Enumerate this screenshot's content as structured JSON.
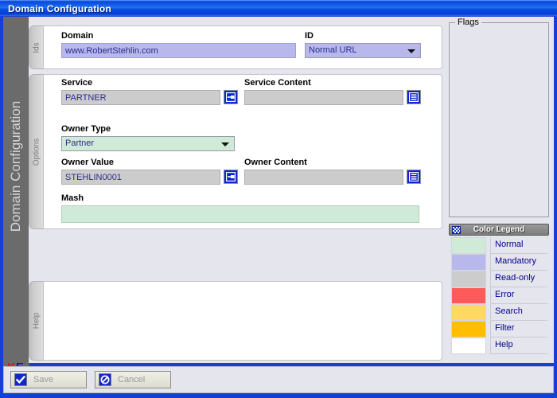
{
  "window": {
    "title": "Domain Configuration"
  },
  "rail": {
    "vertical_title": "Domain Configuration",
    "logo_k": "K",
    "logo_e": "E"
  },
  "tabs": [
    {
      "id": "ids",
      "label": "Ids"
    },
    {
      "id": "options",
      "label": "Options"
    },
    {
      "id": "help",
      "label": "Help"
    }
  ],
  "ids_panel": {
    "domain": {
      "label": "Domain",
      "value": "www.RobertStehlin.com",
      "state": "mandatory"
    },
    "id": {
      "label": "ID",
      "value": "Normal URL",
      "state": "mandatory",
      "options": [
        "Normal URL"
      ]
    }
  },
  "options_panel": {
    "service": {
      "label": "Service",
      "value": "PARTNER",
      "state": "read-only",
      "button_icon": "open-detail-icon"
    },
    "service_content": {
      "label": "Service Content",
      "value": "",
      "state": "read-only",
      "button_icon": "list-icon"
    },
    "owner_type": {
      "label": "Owner Type",
      "value": "Partner",
      "state": "normal",
      "options": [
        "Partner"
      ]
    },
    "owner_value": {
      "label": "Owner Value",
      "value": "STEHLIN0001",
      "state": "read-only",
      "button_icon": "open-detail-icon"
    },
    "owner_content": {
      "label": "Owner Content",
      "value": "",
      "state": "read-only",
      "button_icon": "list-icon"
    },
    "mash": {
      "label": "Mash",
      "value": "",
      "state": "normal"
    }
  },
  "flags": {
    "title": "Flags",
    "items": []
  },
  "legend": {
    "title": "Color Legend",
    "icon": "palette-icon",
    "rows": [
      {
        "label": "Normal",
        "color": "#cfebd8"
      },
      {
        "label": "Mandatory",
        "color": "#b8b8ec"
      },
      {
        "label": "Read-only",
        "color": "#cccccc"
      },
      {
        "label": "Error",
        "color": "#ff5a5a"
      },
      {
        "label": "Search",
        "color": "#ffd964"
      },
      {
        "label": "Filter",
        "color": "#ffbe00"
      },
      {
        "label": "Help",
        "color": "#ffffff"
      }
    ]
  },
  "buttons": {
    "save": {
      "label": "Save",
      "icon": "checkmark-icon"
    },
    "cancel": {
      "label": "Cancel",
      "icon": "no-entry-icon"
    }
  }
}
